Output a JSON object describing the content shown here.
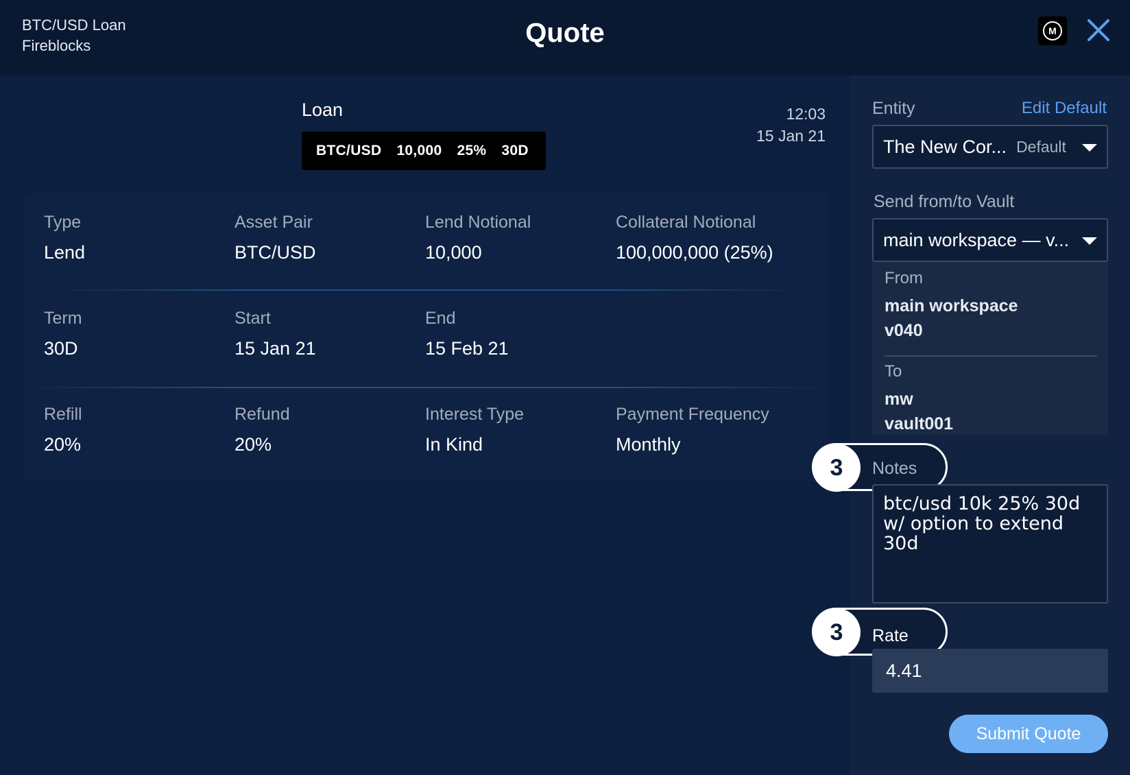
{
  "header": {
    "line1": "BTC/USD Loan",
    "line2": "Fireblocks",
    "title": "Quote",
    "logo_letter": "M",
    "close_icon": "close-icon"
  },
  "loan": {
    "title": "Loan",
    "chip": [
      "BTC/USD",
      "10,000",
      "25%",
      "30D"
    ],
    "time": "12:03",
    "date": "15 Jan 21"
  },
  "details": {
    "row1": [
      {
        "label": "Type",
        "value": "Lend"
      },
      {
        "label": "Asset Pair",
        "value": "BTC/USD"
      },
      {
        "label": "Lend Notional",
        "value": "10,000"
      },
      {
        "label": "Collateral Notional",
        "value": "100,000,000 (25%)"
      }
    ],
    "row2": [
      {
        "label": "Term",
        "value": "30D"
      },
      {
        "label": "Start",
        "value": "15 Jan 21"
      },
      {
        "label": "End",
        "value": "15 Feb 21"
      }
    ],
    "row3": [
      {
        "label": "Refill",
        "value": "20%"
      },
      {
        "label": "Refund",
        "value": "20%"
      },
      {
        "label": "Interest Type",
        "value": "In Kind"
      },
      {
        "label": "Payment Frequency",
        "value": "Monthly"
      }
    ]
  },
  "side": {
    "entity_label": "Entity",
    "edit_default": "Edit Default",
    "entity_value": "The New Cor...",
    "entity_hint": "Default",
    "vault_label": "Send from/to Vault",
    "vault_value": "main workspace — v...",
    "from_label": "From",
    "from_line1": "main workspace",
    "from_line2": "v040",
    "to_label": "To",
    "to_line1": "mw",
    "to_line2": "vault001",
    "notes_step": "3",
    "notes_label": "Notes",
    "notes_value": "btc/usd 10k 25% 30d w/ option to extend 30d",
    "rate_step": "3",
    "rate_label": "Rate",
    "rate_value": "4.41",
    "submit": "Submit Quote"
  },
  "colors": {
    "background": "#0c1f3f",
    "accent": "#6fb0f5",
    "link": "#5aa0f0"
  }
}
